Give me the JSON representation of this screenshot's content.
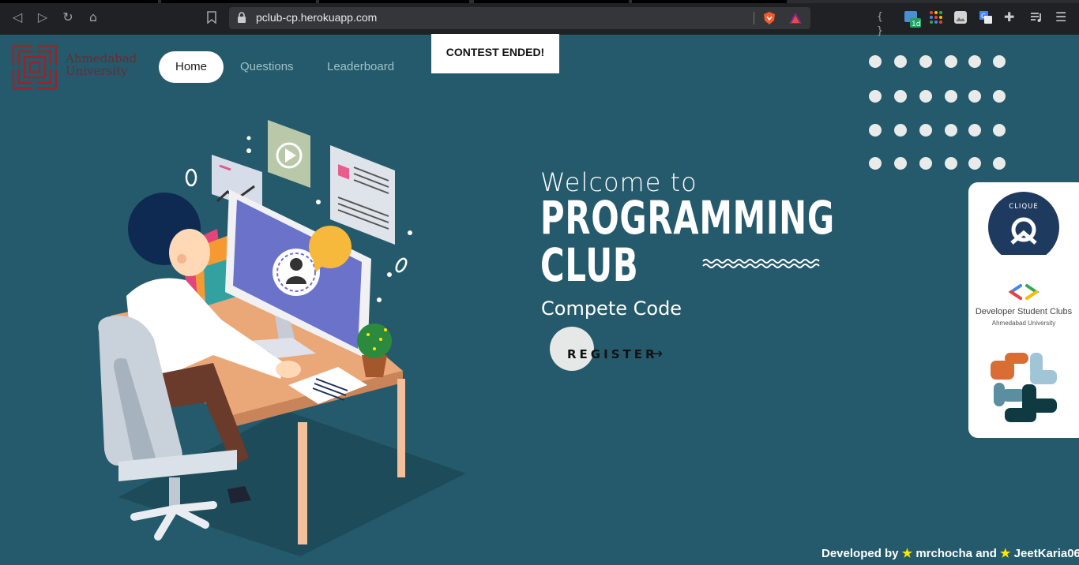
{
  "browser": {
    "url": "pclub-cp.herokuapp.com",
    "badge": "1d"
  },
  "logo": {
    "name_line1": "Ahmedabad",
    "name_line2": "University"
  },
  "nav": {
    "home": "Home",
    "questions": "Questions",
    "leaderboard": "Leaderboard"
  },
  "banner": "CONTEST ENDED!",
  "hero": {
    "welcome": "Welcome to",
    "title_line1": "PROGRAMMING",
    "title_line2": "CLUB",
    "subtitle": "Compete Code",
    "register": "REGISTER",
    "register_arrow": "→"
  },
  "sponsors": {
    "clique": "CLIQUE",
    "dsc_title": "Developer Student Clubs",
    "dsc_sub": "Ahmedabad University"
  },
  "footer": {
    "prefix": "Developed by",
    "star": "★",
    "author1": "mrchocha",
    "and": "and",
    "author2": "JeetKaria06"
  },
  "colors": {
    "background": "#245a6b",
    "accent_star": "#ffe600"
  }
}
